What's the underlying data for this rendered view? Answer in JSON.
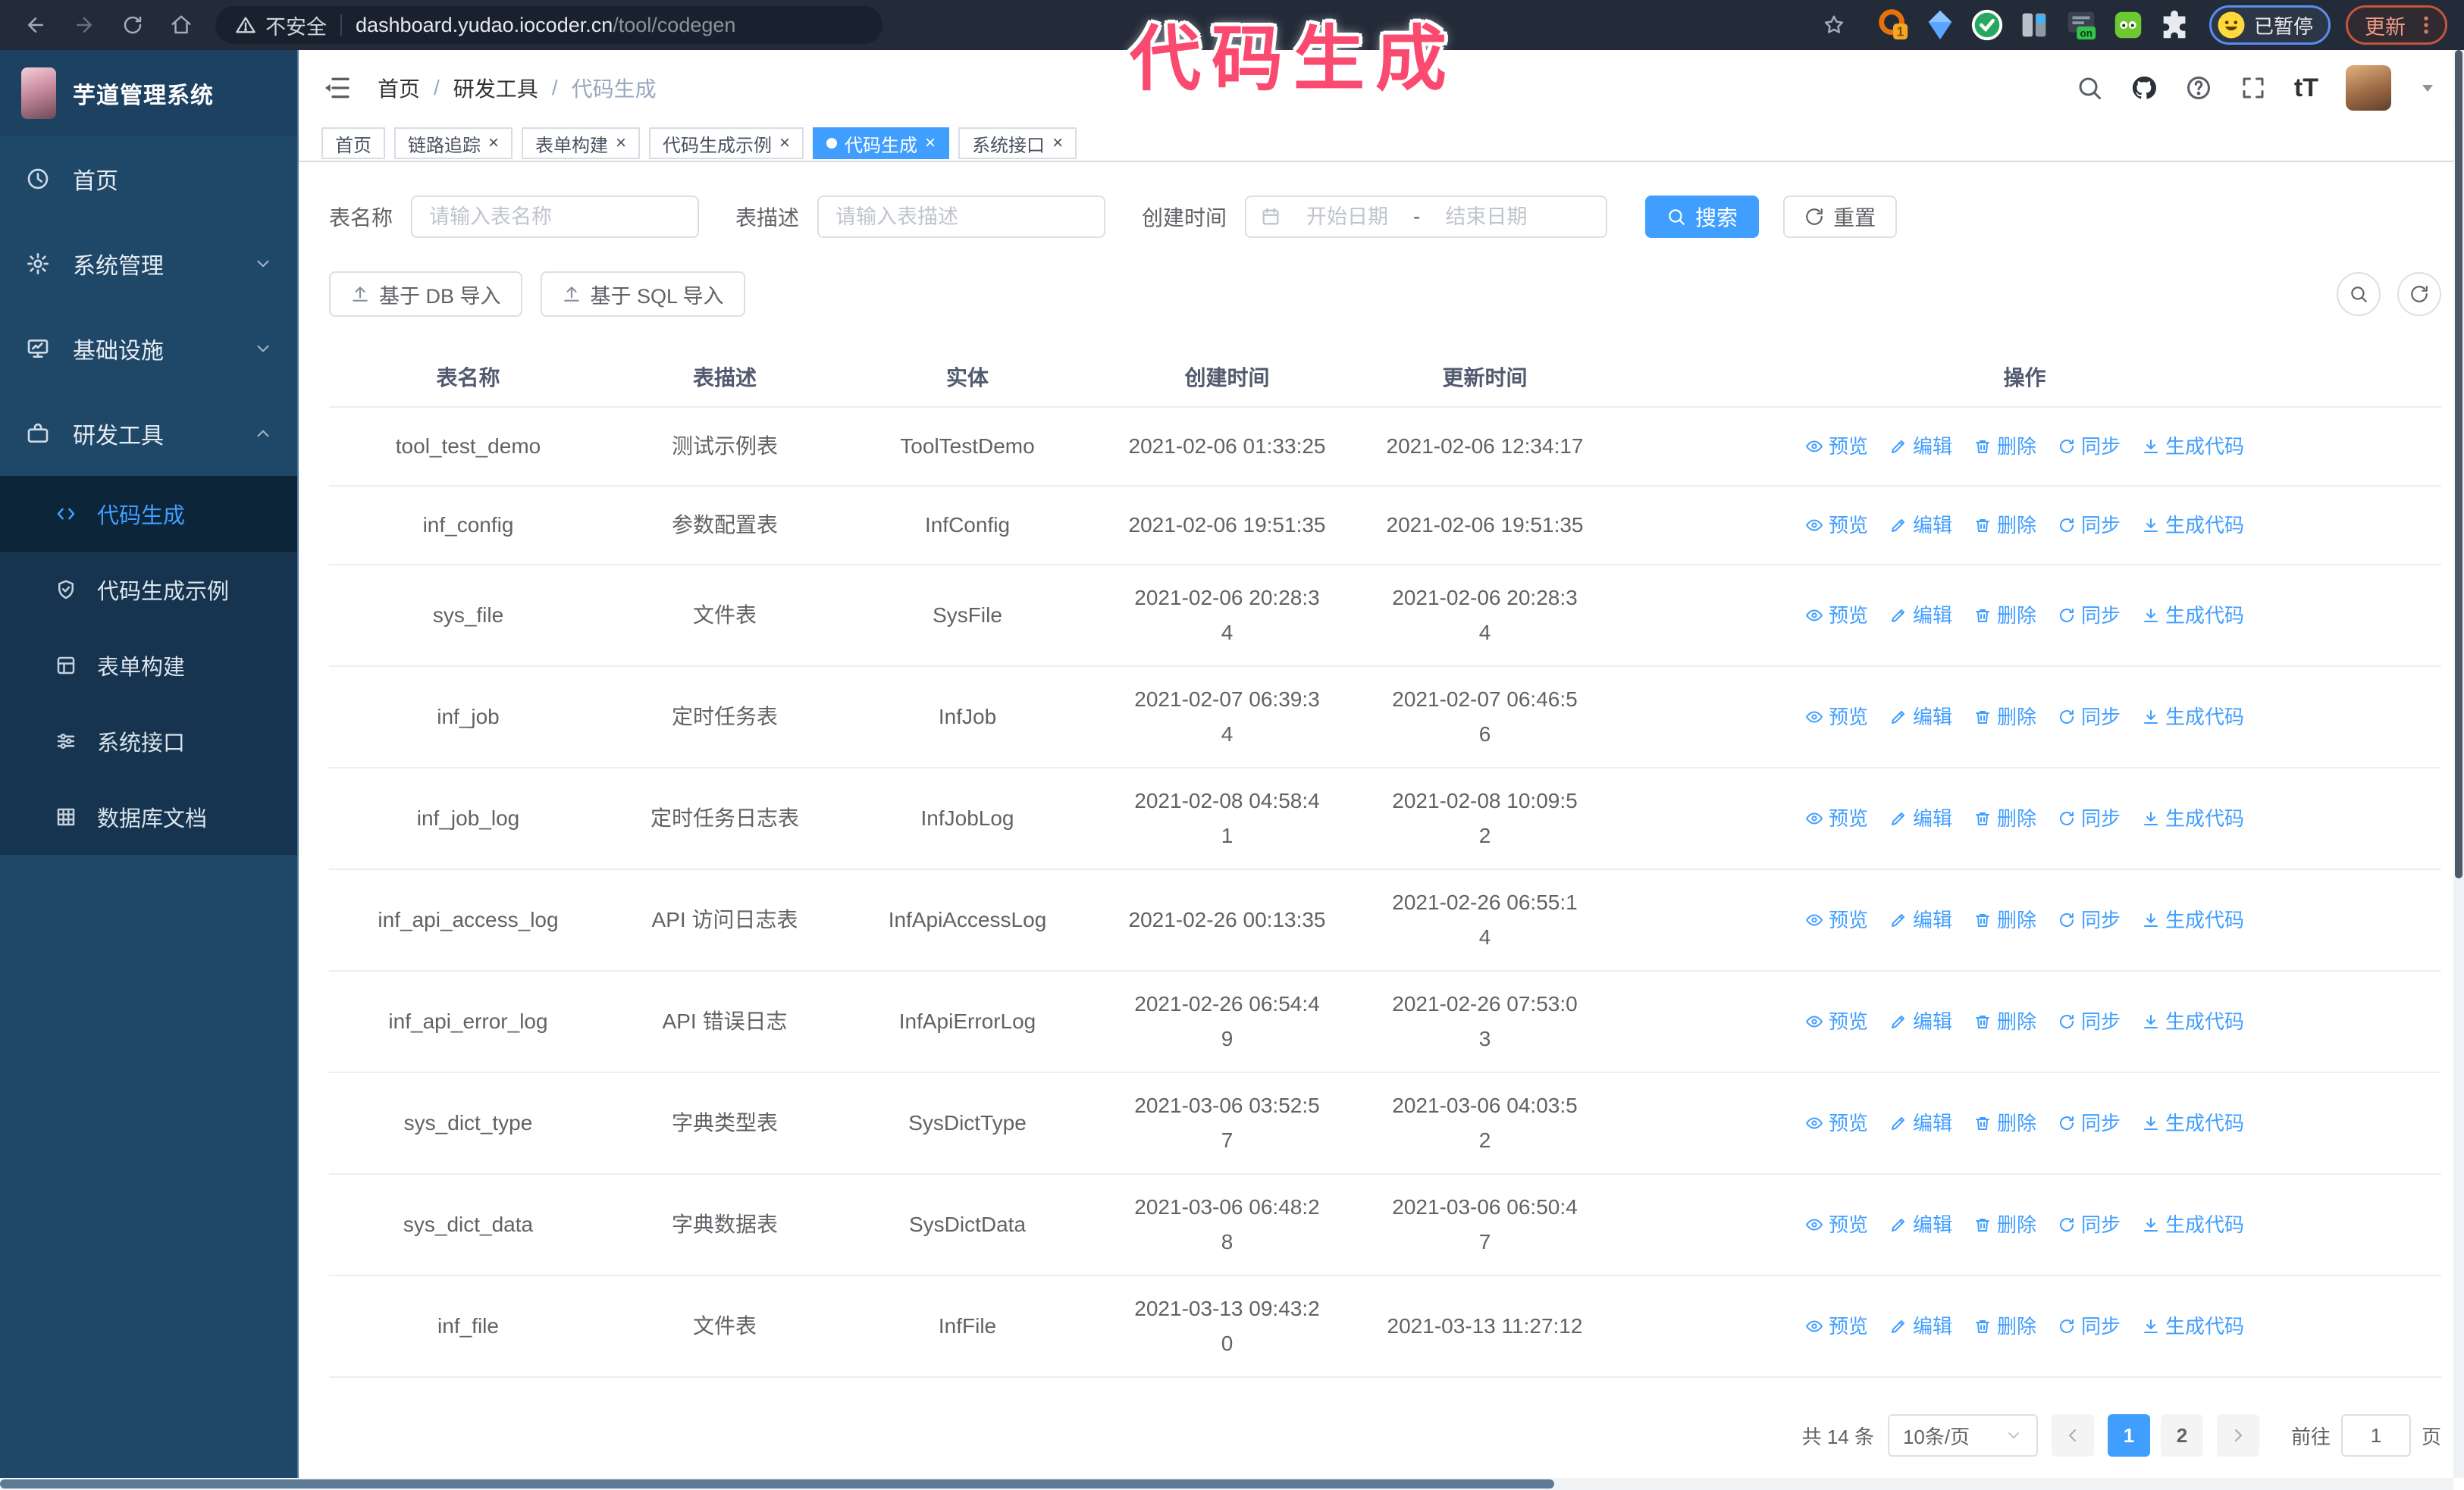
{
  "browser": {
    "security_label": "不安全",
    "url_host": "dashboard.yudao.iocoder.cn",
    "url_path": "/tool/codegen",
    "extension_badge": "1",
    "extension_on_badge": "on",
    "profile_chip": "已暂停",
    "update_button": "更新"
  },
  "annotation": {
    "text": "代码生成",
    "color": "#fa4a6f"
  },
  "app": {
    "title": "芋道管理系统",
    "breadcrumb": [
      "首页",
      "研发工具",
      "代码生成"
    ]
  },
  "sidebar": {
    "items": [
      {
        "id": "home",
        "label": "首页",
        "icon": "dashboard-icon",
        "expandable": false,
        "expanded": false
      },
      {
        "id": "system",
        "label": "系统管理",
        "icon": "gear-icon",
        "expandable": true,
        "expanded": false
      },
      {
        "id": "infra",
        "label": "基础设施",
        "icon": "infra-icon",
        "expandable": true,
        "expanded": false
      },
      {
        "id": "devtools",
        "label": "研发工具",
        "icon": "tools-icon",
        "expandable": true,
        "expanded": true
      }
    ],
    "submenu": [
      {
        "id": "codegen",
        "label": "代码生成",
        "icon": "code-icon",
        "active": true
      },
      {
        "id": "codegen-example",
        "label": "代码生成示例",
        "icon": "example-icon",
        "active": false
      },
      {
        "id": "form-builder",
        "label": "表单构建",
        "icon": "form-icon",
        "active": false
      },
      {
        "id": "system-api",
        "label": "系统接口",
        "icon": "api-icon",
        "active": false
      },
      {
        "id": "db-doc",
        "label": "数据库文档",
        "icon": "db-doc-icon",
        "active": false
      }
    ]
  },
  "tabs": [
    {
      "id": "home",
      "label": "首页",
      "closable": false,
      "active": false
    },
    {
      "id": "trace",
      "label": "链路追踪",
      "closable": true,
      "active": false
    },
    {
      "id": "form-builder",
      "label": "表单构建",
      "closable": true,
      "active": false
    },
    {
      "id": "codegen-example",
      "label": "代码生成示例",
      "closable": true,
      "active": false
    },
    {
      "id": "codegen",
      "label": "代码生成",
      "closable": true,
      "active": true
    },
    {
      "id": "system-api",
      "label": "系统接口",
      "closable": true,
      "active": false
    }
  ],
  "search_form": {
    "table_name_label": "表名称",
    "table_name_placeholder": "请输入表名称",
    "table_desc_label": "表描述",
    "table_desc_placeholder": "请输入表描述",
    "create_time_label": "创建时间",
    "start_date_placeholder": "开始日期",
    "range_separator": "-",
    "end_date_placeholder": "结束日期",
    "search_button": "搜索",
    "reset_button": "重置"
  },
  "toolbar": {
    "import_db_button": "基于 DB 导入",
    "import_sql_button": "基于 SQL 导入"
  },
  "table": {
    "columns": [
      "表名称",
      "表描述",
      "实体",
      "创建时间",
      "更新时间",
      "操作"
    ],
    "actions": [
      "预览",
      "编辑",
      "删除",
      "同步",
      "生成代码"
    ],
    "rows": [
      {
        "name": "tool_test_demo",
        "desc": "测试示例表",
        "entity": "ToolTestDemo",
        "create_time": "2021-02-06 01:33:25",
        "create_wrap": false,
        "update_time": "2021-02-06 12:34:17",
        "update_wrap": false
      },
      {
        "name": "inf_config",
        "desc": "参数配置表",
        "entity": "InfConfig",
        "create_time": "2021-02-06 19:51:35",
        "create_wrap": false,
        "update_time": "2021-02-06 19:51:35",
        "update_wrap": false
      },
      {
        "name": "sys_file",
        "desc": "文件表",
        "entity": "SysFile",
        "create_time": "2021-02-06 20:28:34",
        "create_wrap": true,
        "update_time": "2021-02-06 20:28:34",
        "update_wrap": true
      },
      {
        "name": "inf_job",
        "desc": "定时任务表",
        "entity": "InfJob",
        "create_time": "2021-02-07 06:39:34",
        "create_wrap": true,
        "update_time": "2021-02-07 06:46:56",
        "update_wrap": true
      },
      {
        "name": "inf_job_log",
        "desc": "定时任务日志表",
        "entity": "InfJobLog",
        "create_time": "2021-02-08 04:58:41",
        "create_wrap": true,
        "update_time": "2021-02-08 10:09:52",
        "update_wrap": true
      },
      {
        "name": "inf_api_access_log",
        "desc": "API 访问日志表",
        "entity": "InfApiAccessLog",
        "create_time": "2021-02-26 00:13:35",
        "create_wrap": false,
        "update_time": "2021-02-26 06:55:14",
        "update_wrap": true
      },
      {
        "name": "inf_api_error_log",
        "desc": "API 错误日志",
        "entity": "InfApiErrorLog",
        "create_time": "2021-02-26 06:54:49",
        "create_wrap": true,
        "update_time": "2021-02-26 07:53:03",
        "update_wrap": true
      },
      {
        "name": "sys_dict_type",
        "desc": "字典类型表",
        "entity": "SysDictType",
        "create_time": "2021-03-06 03:52:57",
        "create_wrap": true,
        "update_time": "2021-03-06 04:03:52",
        "update_wrap": true
      },
      {
        "name": "sys_dict_data",
        "desc": "字典数据表",
        "entity": "SysDictData",
        "create_time": "2021-03-06 06:48:28",
        "create_wrap": true,
        "update_time": "2021-03-06 06:50:47",
        "update_wrap": true
      },
      {
        "name": "inf_file",
        "desc": "文件表",
        "entity": "InfFile",
        "create_time": "2021-03-13 09:43:20",
        "create_wrap": true,
        "update_time": "2021-03-13 11:27:12",
        "update_wrap": false
      }
    ]
  },
  "pagination": {
    "total_text": "共 14 条",
    "page_size": "10条/页",
    "pages": [
      "1",
      "2"
    ],
    "active_page": "1",
    "goto_label": "前往",
    "goto_value": "1",
    "goto_suffix": "页"
  },
  "colors": {
    "primary": "#409eff",
    "sidebar_bg": "#1f4768",
    "submenu_bg": "#16344f",
    "annotation_pink": "#fa4a6f"
  }
}
